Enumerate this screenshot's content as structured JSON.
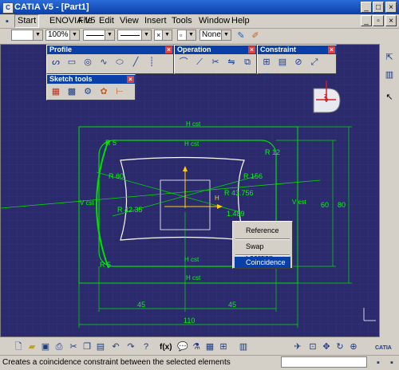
{
  "window": {
    "title": "CATIA V5 - [Part1]"
  },
  "menubar": {
    "items": [
      "Start",
      "ENOVIA V5",
      "File",
      "Edit",
      "View",
      "Insert",
      "Tools",
      "Window",
      "Help"
    ]
  },
  "toolbar": {
    "zoom_value": "100%",
    "layer_value": "None"
  },
  "floating_toolbars": {
    "profile": "Profile",
    "operation": "Operation",
    "constraint": "Constraint",
    "sketch_tools": "Sketch tools"
  },
  "sketch": {
    "dims": {
      "r5_top": "R 5",
      "r12": "R 12",
      "r60": "R 60",
      "r156": "R 156",
      "r43": "R 43.756",
      "r42": "R 42.35",
      "v1489": "1.489",
      "r5_bottom": "R 5",
      "d45_left": "45",
      "d45_right": "45",
      "d110": "110",
      "d60": "60",
      "d80": "80"
    },
    "labels": {
      "h_top_outer": "H cst",
      "h_top_inner": "H cst",
      "h_bottom_inner": "H cst",
      "h_bottom_outer": "H cst",
      "v_left": "V cst",
      "v_right": "V cst",
      "h_center": "H"
    }
  },
  "compass": {
    "axis": "z"
  },
  "context_menu": {
    "items": [
      "Reference",
      "Swap Location",
      "Coincidence"
    ],
    "selected": "Coincidence"
  },
  "bottom_toolbar": {
    "fx_label": "f(x)"
  },
  "logo": {
    "text": "CATIA"
  },
  "status": {
    "message": "Creates a coincidence constraint between the selected elements"
  }
}
